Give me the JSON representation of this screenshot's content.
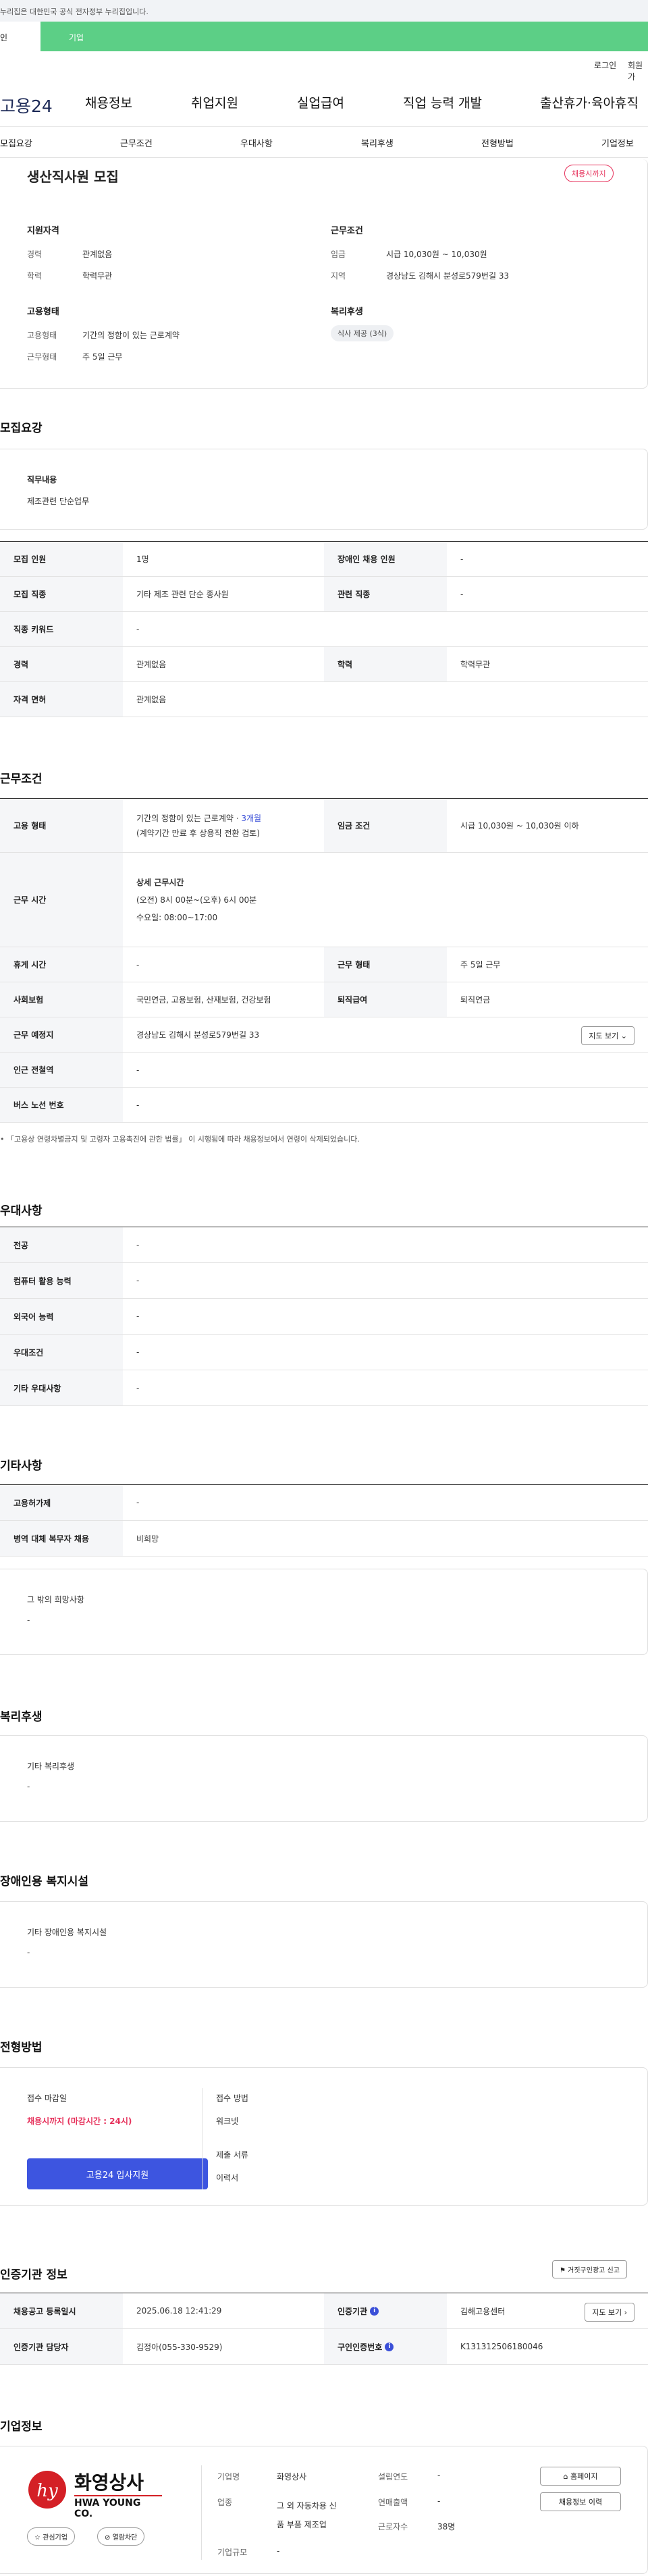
{
  "gov_banner": "누리집은 대한민국 공식 전자정부 누리집입니다.",
  "top_tabs": {
    "t1": "인",
    "t2": "기업"
  },
  "util": {
    "login": "로그인",
    "join": "회원가"
  },
  "logo": "고용24",
  "gnb": [
    "채용정보",
    "취업지원",
    "실업급여",
    "직업 능력 개발",
    "출산휴가·육아휴직"
  ],
  "subnav": [
    "모집요강",
    "근무조건",
    "우대사항",
    "복리후생",
    "전형방법",
    "기업정보"
  ],
  "summary": {
    "title": "생산직사원 모집",
    "status": "채용시까지",
    "qual_title": "지원자격",
    "career_lbl": "경력",
    "career": "관계없음",
    "edu_lbl": "학력",
    "edu": "학력무관",
    "cond_title": "근무조건",
    "wage_lbl": "임금",
    "wage": "시급 10,030원 ~ 10,030원",
    "area_lbl": "지역",
    "area": "경상남도 김해시 분성로579번길 33",
    "emp_title": "고용형태",
    "emp_lbl": "고용형태",
    "emp": "기간의 정함이 있는 근로계약",
    "work_lbl": "근무형태",
    "work": "주 5일 근무",
    "welfare_title": "복리후생",
    "welfare_tag": "식사 제공 (3식)"
  },
  "recruit": {
    "heading": "모집요강",
    "duty_lbl": "직무내용",
    "duty": "제조관련 단순업무",
    "rows": [
      {
        "k1": "모집 인원",
        "v1": "1명",
        "k2": "장애인 채용 인원",
        "v2": "-"
      },
      {
        "k1": "모집 직종",
        "v1": "기타 제조 관련 단순 종사원",
        "k2": "관련 직종",
        "v2": "-"
      },
      {
        "k1": "직종 키워드",
        "v1": "-"
      },
      {
        "k1": "경력",
        "v1": "관계없음",
        "k2": "학력",
        "v2": "학력무관"
      },
      {
        "k1": "자격 면허",
        "v1": "관계없음"
      }
    ]
  },
  "conditions": {
    "heading": "근무조건",
    "emp_k": "고용 형태",
    "emp_v1": "기간의 정함이 있는 근로계약 · ",
    "emp_v1b": "3개월",
    "emp_v2": "(계약기간 만료 후 상용직 전환 검토)",
    "wage_k": "임금 조건",
    "wage_v": "시급 10,030원 ~ 10,030원 이하",
    "time_k": "근무 시간",
    "time_v1": "상세 근무시간",
    "time_v2": "(오전) 8시 00분~(오후) 6시 00분",
    "time_v3": "수요일: 08:00~17:00",
    "rest_k": "휴게 시간",
    "rest_v": "-",
    "form_k": "근무 형태",
    "form_v": "주 5일 근무",
    "ins_k": "사회보험",
    "ins_v": "국민연금, 고용보험, 산재보험, 건강보험",
    "ret_k": "퇴직급여",
    "ret_v": "퇴직연금",
    "place_k": "근무 예정지",
    "place_v": "경상남도 김해시 분성로579번길 33",
    "map_btn": "지도 보기",
    "station_k": "인근 전철역",
    "station_v": "-",
    "bus_k": "버스 노선 번호",
    "bus_v": "-",
    "note": "「고용상 연령차별금지 및 고령자 고용촉진에 관한 법률」 이 시행됨에 따라 채용정보에서 연령이 삭제되었습니다."
  },
  "preference": {
    "heading": "우대사항",
    "rows": [
      {
        "k": "전공",
        "v": "-"
      },
      {
        "k": "컴퓨터 활용 능력",
        "v": "-"
      },
      {
        "k": "외국어 능력",
        "v": "-"
      },
      {
        "k": "우대조건",
        "v": "-"
      },
      {
        "k": "기타 우대사항",
        "v": "-"
      }
    ]
  },
  "etc": {
    "heading": "기타사항",
    "rows": [
      {
        "k": "고용허가제",
        "v": "-"
      },
      {
        "k": "병역 대체 복무자 채용",
        "v": "비희망"
      }
    ],
    "other_lbl": "그 밖의 희망사항",
    "other_v": "-"
  },
  "welfare": {
    "heading": "복리후생",
    "lbl": "기타 복리후생",
    "v": "-"
  },
  "disability": {
    "heading": "장애인용 복지시설",
    "lbl": "기타 장애인용 복지시설",
    "v": "-"
  },
  "selection": {
    "heading": "전형방법",
    "deadline_lbl": "접수 마감일",
    "deadline": "채용시까지 (마감시간 : 24시)",
    "apply_btn": "고용24 입사지원",
    "method_lbl": "접수 방법",
    "method": "워크넷",
    "docs_lbl": "제출 서류",
    "docs": "이력서"
  },
  "agency": {
    "heading": "인증기관 정보",
    "report_btn": "거짓구인광고 신고",
    "reg_k": "채용공고 등록일시",
    "reg_v": "2025.06.18 12:41:29",
    "org_k": "인증기관",
    "org_v": "김해고용센터",
    "map_btn": "지도 보기",
    "mgr_k": "인증기관 담당자",
    "mgr_v": "김정아(055-330-9529)",
    "no_k": "구인인증번호",
    "no_v": "K131312506180046"
  },
  "company": {
    "heading": "기업정보",
    "logo_kr": "화영상사",
    "logo_en": "HWA YOUNG CO.",
    "fav_btn": "관심기업",
    "block_btn": "열람차단",
    "name_k": "기업명",
    "name_v": "화영상사",
    "ind_k": "업종",
    "ind_v1": "그 외 자동차용 신",
    "ind_v2": "품 부품 제조업",
    "size_k": "기업규모",
    "size_v": "-",
    "est_k": "설립연도",
    "est_v": "-",
    "sales_k": "연매출액",
    "sales_v": "-",
    "emp_k": "근로자수",
    "emp_v": "38명",
    "home_btn": "홈페이지",
    "history_btn": "채용정보 이력"
  },
  "colors": {
    "green": "#5ccf86",
    "pink": "#e6315b",
    "blue": "#3a4fd8",
    "button": "#3d55e0"
  }
}
